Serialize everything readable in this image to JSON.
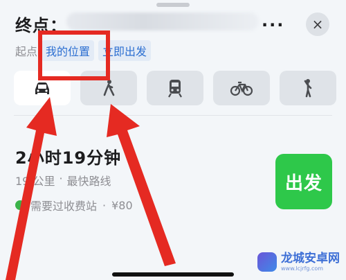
{
  "header": {
    "dest_label": "终点：",
    "dest_more": "...",
    "close_glyph": "×"
  },
  "start": {
    "label": "起点",
    "my_location": "我的位置",
    "depart_now": "立即出发"
  },
  "modes": [
    "drive",
    "taxi",
    "transit",
    "bike",
    "walk"
  ],
  "route": {
    "time": "2小时19分钟",
    "distance": "19 公里",
    "separator": "·",
    "tag": "最快路线",
    "toll_text": "需要过收费站",
    "toll_price": "¥80",
    "go_label": "出发"
  },
  "watermark": {
    "title": "龙城安卓网",
    "url": "www.lcjrfg.com"
  },
  "colors": {
    "accent_blue": "#2c6fd1",
    "go_green": "#2ec84a",
    "annotation_red": "#e52a22"
  }
}
